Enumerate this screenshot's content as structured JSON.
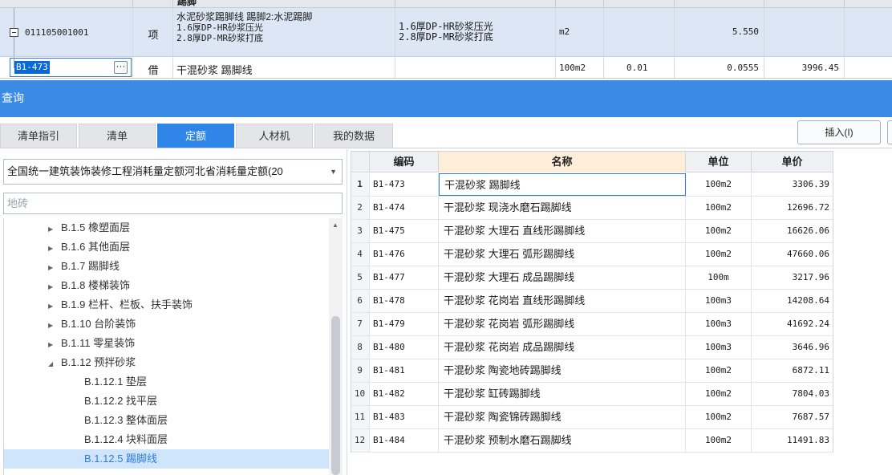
{
  "bill_table": {
    "header_fragment": "踢脚",
    "item_row": {
      "code": "011105001001",
      "type": "项",
      "name_lines": [
        "水泥砂浆踢脚线  踢脚2:水泥踢脚",
        "1.6厚DP-HR砂浆压光",
        "2.8厚DP-MR砂浆打底"
      ],
      "feature_lines": [
        "1.6厚DP-HR砂浆压光",
        "2.8厚DP-MR砂浆打底"
      ],
      "unit": "m2",
      "quantity": "5.550"
    },
    "sub_row": {
      "code": "B1-473",
      "type": "借",
      "name": "干混砂浆 踢脚线",
      "unit": "100m2",
      "coefficient": "0.01",
      "quantity": "0.0555",
      "price": "3996.45"
    }
  },
  "panel": {
    "title": "查询",
    "tabs": [
      "清单指引",
      "清单",
      "定额",
      "人材机",
      "我的数据"
    ],
    "active_tab_index": 2,
    "insert_button": "插入(I)",
    "library_select": "全国统一建筑装饰装修工程消耗量定额河北省消耗量定额(20",
    "search_value": "",
    "search_placeholder": "地砖"
  },
  "tree": [
    {
      "label": "B.1.5 橡塑面层",
      "level": 1,
      "arrow": "▶"
    },
    {
      "label": "B.1.6 其他面层",
      "level": 1,
      "arrow": "▶"
    },
    {
      "label": "B.1.7 踢脚线",
      "level": 1,
      "arrow": "▶"
    },
    {
      "label": "B.1.8 楼梯装饰",
      "level": 1,
      "arrow": "▶"
    },
    {
      "label": "B.1.9 栏杆、栏板、扶手装饰",
      "level": 1,
      "arrow": "▶"
    },
    {
      "label": "B.1.10 台阶装饰",
      "level": 1,
      "arrow": "▶"
    },
    {
      "label": "B.1.11 零星装饰",
      "level": 1,
      "arrow": "▶"
    },
    {
      "label": "B.1.12 预拌砂浆",
      "level": 1,
      "arrow": "◢"
    },
    {
      "label": "B.1.12.1 垫层",
      "level": 2,
      "arrow": ""
    },
    {
      "label": "B.1.12.2 找平层",
      "level": 2,
      "arrow": ""
    },
    {
      "label": "B.1.12.3 整体面层",
      "level": 2,
      "arrow": ""
    },
    {
      "label": "B.1.12.4 块料面层",
      "level": 2,
      "arrow": ""
    },
    {
      "label": "B.1.12.5 踢脚线",
      "level": 2,
      "arrow": "",
      "selected": true
    }
  ],
  "grid": {
    "headers": [
      "",
      "编码",
      "名称",
      "单位",
      "单价"
    ],
    "rows": [
      {
        "idx": "1",
        "code": "B1-473",
        "name": "干混砂浆 踢脚线",
        "unit": "100m2",
        "price": "3306.39"
      },
      {
        "idx": "2",
        "code": "B1-474",
        "name": "干混砂浆 现浇水磨石踢脚线",
        "unit": "100m2",
        "price": "12696.72"
      },
      {
        "idx": "3",
        "code": "B1-475",
        "name": "干混砂浆 大理石 直线形踢脚线",
        "unit": "100m2",
        "price": "16626.06"
      },
      {
        "idx": "4",
        "code": "B1-476",
        "name": "干混砂浆 大理石 弧形踢脚线",
        "unit": "100m2",
        "price": "47660.06"
      },
      {
        "idx": "5",
        "code": "B1-477",
        "name": "干混砂浆 大理石 成品踢脚线",
        "unit": "100m",
        "price": "3217.96"
      },
      {
        "idx": "6",
        "code": "B1-478",
        "name": "干混砂浆 花岗岩 直线形踢脚线",
        "unit": "100m3",
        "price": "14208.64"
      },
      {
        "idx": "7",
        "code": "B1-479",
        "name": "干混砂浆 花岗岩 弧形踢脚线",
        "unit": "100m3",
        "price": "41692.24"
      },
      {
        "idx": "8",
        "code": "B1-480",
        "name": "干混砂浆 花岗岩 成品踢脚线",
        "unit": "100m3",
        "price": "3646.96"
      },
      {
        "idx": "9",
        "code": "B1-481",
        "name": "干混砂浆 陶瓷地砖踢脚线",
        "unit": "100m2",
        "price": "6872.11"
      },
      {
        "idx": "10",
        "code": "B1-482",
        "name": "干混砂浆 缸砖踢脚线",
        "unit": "100m2",
        "price": "7804.03"
      },
      {
        "idx": "11",
        "code": "B1-483",
        "name": "干混砂浆 陶瓷锦砖踢脚线",
        "unit": "100m2",
        "price": "7687.57"
      },
      {
        "idx": "12",
        "code": "B1-484",
        "name": "干混砂浆 预制水磨石踢脚线",
        "unit": "100m2",
        "price": "11491.83"
      }
    ]
  },
  "colors": {
    "accent": "#2f86e8",
    "title_bar": "#3b8be6",
    "selection": "#0a68d8",
    "name_header": "#fdeed9"
  }
}
